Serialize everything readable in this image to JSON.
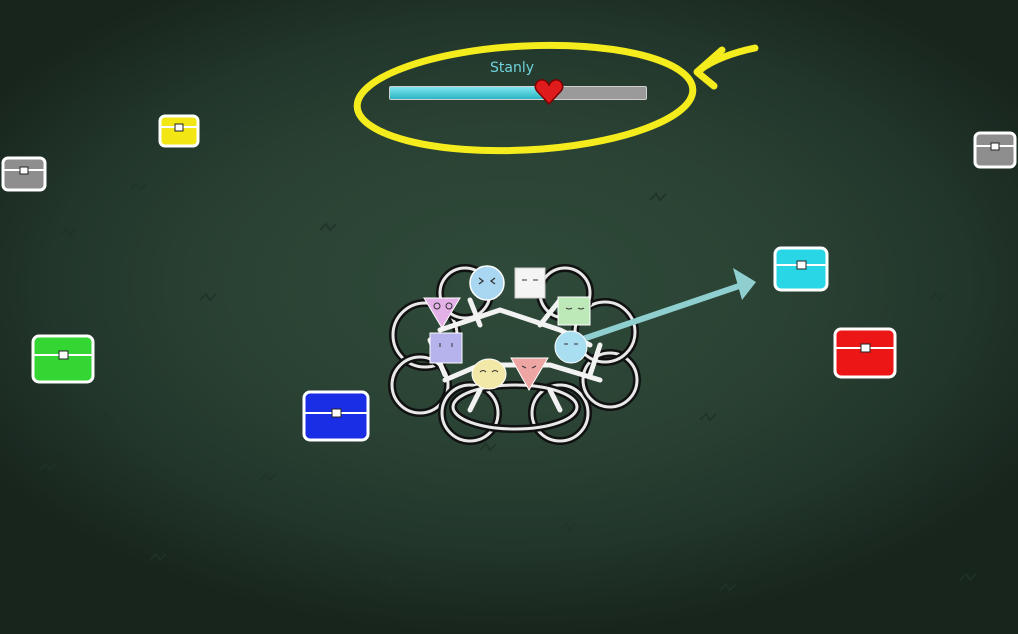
{
  "player": {
    "name": "Stanly",
    "health_fraction": 0.62
  },
  "chests": [
    {
      "id": "yellow",
      "color": "#f2e614"
    },
    {
      "id": "gray-left",
      "color": "#8e8e8e"
    },
    {
      "id": "gray-right",
      "color": "#8e8e8e"
    },
    {
      "id": "cyan",
      "color": "#28d6e6"
    },
    {
      "id": "green",
      "color": "#34d634"
    },
    {
      "id": "blue",
      "color": "#1a2ee6"
    },
    {
      "id": "red",
      "color": "#ec1616"
    }
  ],
  "colors": {
    "highlight": "#f4ec1c",
    "arrow": "#8fcfcf",
    "health_fill": "#2ab6c4",
    "heart": "#e01b1b"
  },
  "icons": {
    "heart": "heart-icon",
    "lock": "lock-icon"
  }
}
